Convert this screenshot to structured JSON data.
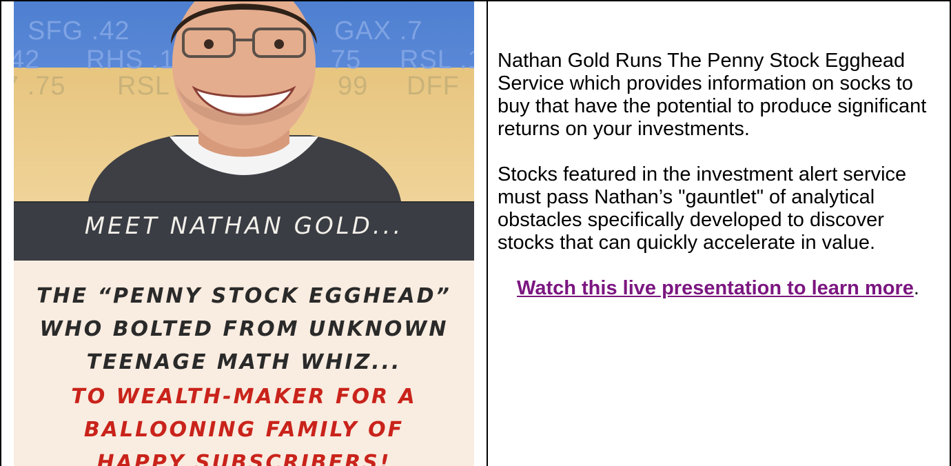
{
  "promo": {
    "ticker_rows": [
      [
        "SFG .42",
        "GAX .7"
      ],
      [
        "42",
        "RHS .1",
        "75",
        "RSL .1"
      ],
      [
        "7 .75",
        "RSL",
        "99",
        "DFF"
      ]
    ],
    "banner_title": "MEET NATHAN GOLD...",
    "headline_lines": [
      "THE “PENNY STOCK EGGHEAD”",
      "WHO BOLTED FROM UNKNOWN",
      "TEENAGE MATH WHIZ..."
    ],
    "subhead_lines": [
      "TO WEALTH-MAKER FOR A",
      "BALLOONING FAMILY OF",
      "HAPPY SUBSCRIBERS!"
    ],
    "colors": {
      "sky": "#5d8ad8",
      "gold": "#efd398",
      "bar": "#3a3d44",
      "red": "#c9231b",
      "cream": "#f9ece0"
    }
  },
  "content": {
    "paragraph_1": "Nathan Gold Runs The Penny Stock Egghead Service which provides information on socks to buy that have the potential to produce significant returns on your investments.",
    "paragraph_2": "Stocks featured in the investment alert service must pass Nathan’s \"gauntlet\" of analytical obstacles specifically developed to discover stocks that can quickly accelerate in value.",
    "link_text": "Watch this live presentation to learn more",
    "link_suffix": ".",
    "link_color": "#7b1680"
  }
}
